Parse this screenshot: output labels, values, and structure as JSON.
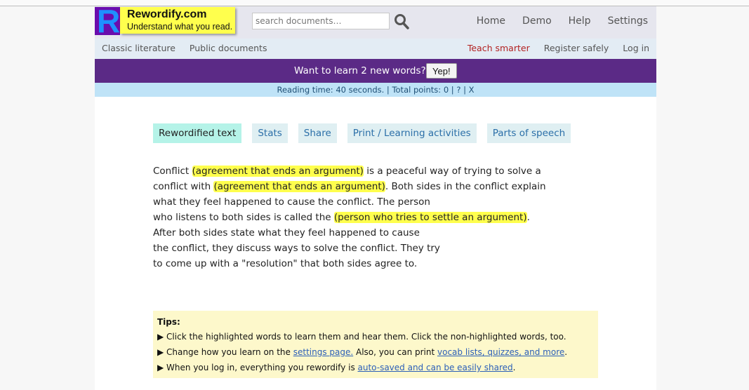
{
  "header": {
    "logo_letter": "R",
    "logo_title": "Rewordify.com",
    "logo_subtitle": "Understand what you read.",
    "search_placeholder": "search documents…",
    "nav": [
      "Home",
      "Demo",
      "Help",
      "Settings"
    ]
  },
  "subnav": {
    "left": [
      "Classic literature",
      "Public documents"
    ],
    "right": [
      "Teach smarter",
      "Register safely",
      "Log in"
    ]
  },
  "banner": {
    "text": "Want to learn 2 new words?",
    "button": "Yep!"
  },
  "statsbar": {
    "text": "Reading time: 40 seconds. | Total points: 0 |",
    "help_link": "?",
    "sep": "|",
    "close_link": "X"
  },
  "tabs": [
    "Rewordified text",
    "Stats",
    "Share",
    "Print / Learning activities",
    "Parts of speech"
  ],
  "content": {
    "l1a": "Conflict ",
    "l1h": "(agreement that ends an argument)",
    "l1b": " is a peaceful way of trying to solve a",
    "l2a": "conflict with ",
    "l2h": "(agreement that ends an argument)",
    "l2b": ". Both sides in the conflict explain",
    "l3": "what they feel happened to cause the conflict. The person",
    "l4a": "who listens to both sides is called the ",
    "l4h": "(person who tries to settle an argument)",
    "l4b": ".",
    "l5": "After both sides state what they feel happened to cause",
    "l6": "the conflict, they discuss ways to solve the conflict. They try",
    "l7": "to come up with a \"resolution\" that both sides agree to."
  },
  "tips": {
    "title": "Tips:",
    "t1": "▶ Click the highlighted words to learn them and hear them. Click the non-highlighted words, too.",
    "t2a": "▶ Change how you learn on the ",
    "t2link1": "settings page.",
    "t2b": " Also, you can print ",
    "t2link2": "vocab lists, quizzes, and more",
    "t2c": ".",
    "t3a": "▶ When you log in, everything you rewordify is ",
    "t3link": "auto-saved and can be easily shared",
    "t3b": "."
  },
  "colors": {
    "banner": "#5b2a86",
    "highlight": "#ffff4d",
    "statsbar": "#bfe3f7",
    "tips_bg": "#fdf8cb"
  },
  "icons": {
    "search": "magnifier-icon"
  }
}
